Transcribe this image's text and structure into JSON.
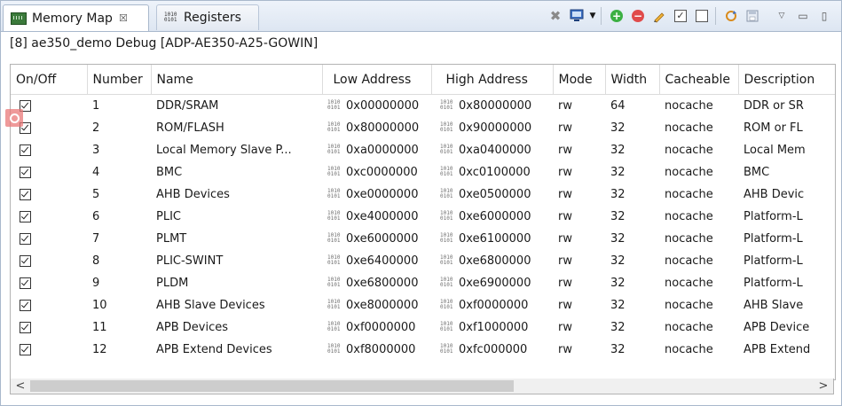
{
  "tabs": [
    {
      "label": "Memory Map",
      "close": "☒",
      "icon": "memory-map-icon"
    },
    {
      "label": "Registers",
      "icon": "registers-icon",
      "binary_top": "1010",
      "binary_bottom": "0101"
    }
  ],
  "session": "[8] ae350_demo Debug [ADP-AE350-A25-GOWIN]",
  "columns": [
    "On/Off",
    "Number",
    "Name",
    "Low Address",
    "High Address",
    "Mode",
    "Width",
    "Cacheable",
    "Description"
  ],
  "binary_glyph": {
    "top": "1010",
    "bottom": "0101"
  },
  "rows": [
    {
      "checked": true,
      "number": "1",
      "name": "DDR/SRAM",
      "low": "0x00000000",
      "high": "0x80000000",
      "mode": "rw",
      "width": "64",
      "cache": "nocache",
      "desc": "DDR or SR"
    },
    {
      "checked": true,
      "number": "2",
      "name": "ROM/FLASH",
      "low": "0x80000000",
      "high": "0x90000000",
      "mode": "rw",
      "width": "32",
      "cache": "nocache",
      "desc": "ROM or FL"
    },
    {
      "checked": true,
      "number": "3",
      "name": "Local Memory Slave P...",
      "low": "0xa0000000",
      "high": "0xa0400000",
      "mode": "rw",
      "width": "32",
      "cache": "nocache",
      "desc": "Local Mem"
    },
    {
      "checked": true,
      "number": "4",
      "name": "BMC",
      "low": "0xc0000000",
      "high": "0xc0100000",
      "mode": "rw",
      "width": "32",
      "cache": "nocache",
      "desc": "BMC"
    },
    {
      "checked": true,
      "number": "5",
      "name": "AHB Devices",
      "low": "0xe0000000",
      "high": "0xe0500000",
      "mode": "rw",
      "width": "32",
      "cache": "nocache",
      "desc": "AHB Devic"
    },
    {
      "checked": true,
      "number": "6",
      "name": "PLIC",
      "low": "0xe4000000",
      "high": "0xe6000000",
      "mode": "rw",
      "width": "32",
      "cache": "nocache",
      "desc": "Platform-L"
    },
    {
      "checked": true,
      "number": "7",
      "name": "PLMT",
      "low": "0xe6000000",
      "high": "0xe6100000",
      "mode": "rw",
      "width": "32",
      "cache": "nocache",
      "desc": "Platform-L"
    },
    {
      "checked": true,
      "number": "8",
      "name": "PLIC-SWINT",
      "low": "0xe6400000",
      "high": "0xe6800000",
      "mode": "rw",
      "width": "32",
      "cache": "nocache",
      "desc": "Platform-L"
    },
    {
      "checked": true,
      "number": "9",
      "name": "PLDM",
      "low": "0xe6800000",
      "high": "0xe6900000",
      "mode": "rw",
      "width": "32",
      "cache": "nocache",
      "desc": "Platform-L"
    },
    {
      "checked": true,
      "number": "10",
      "name": "AHB Slave Devices",
      "low": "0xe8000000",
      "high": "0xf0000000",
      "mode": "rw",
      "width": "32",
      "cache": "nocache",
      "desc": "AHB Slave"
    },
    {
      "checked": true,
      "number": "11",
      "name": "APB Devices",
      "low": "0xf0000000",
      "high": "0xf1000000",
      "mode": "rw",
      "width": "32",
      "cache": "nocache",
      "desc": "APB Device"
    },
    {
      "checked": true,
      "number": "12",
      "name": "APB Extend Devices",
      "low": "0xf8000000",
      "high": "0xfc000000",
      "mode": "rw",
      "width": "32",
      "cache": "nocache",
      "desc": "APB Extend"
    }
  ],
  "scroll": {
    "left_arrow": "<",
    "right_arrow": ">"
  },
  "colors": {
    "tab_bg": "#dde6f2",
    "add": "#3cb043",
    "remove": "#e04b4b",
    "border": "#a9b8cc"
  }
}
